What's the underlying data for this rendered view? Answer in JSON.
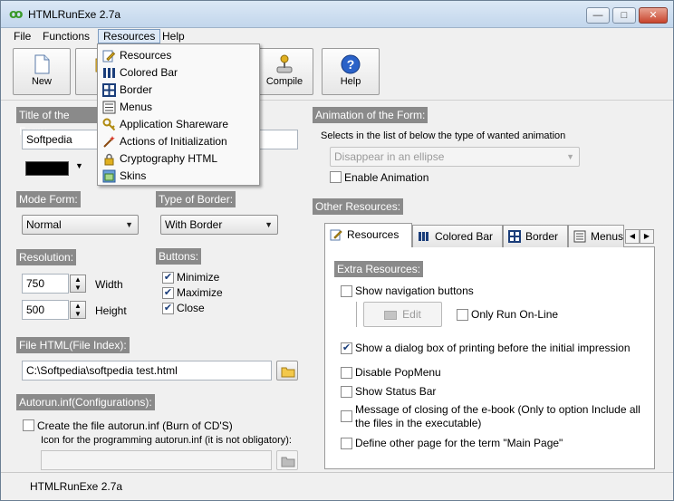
{
  "window": {
    "title": "HTMLRunExe 2.7a",
    "minimize": "—",
    "maximize": "□",
    "close": "✕"
  },
  "menubar": {
    "items": [
      "File",
      "Functions",
      "Resources",
      "Help"
    ]
  },
  "toolbar": {
    "new_label": "New",
    "open_label": "Op",
    "compile_label": "Compile",
    "help_label": "Help"
  },
  "resources_menu": {
    "items": [
      "Resources",
      "Colored Bar",
      "Border",
      "Menus",
      "Application Shareware",
      "Actions of Initialization",
      "Cryptography HTML",
      "Skins"
    ]
  },
  "form_title": {
    "label": "Title of the Form:",
    "value": "Softpedia",
    "color_value": "#000000"
  },
  "mode_form": {
    "label": "Mode Form:",
    "value": "Normal"
  },
  "border_type": {
    "label": "Type of Border:",
    "value": "With Border"
  },
  "resolution": {
    "label": "Resolution:",
    "width_value": "750",
    "width_label": "Width",
    "height_value": "500",
    "height_label": "Height"
  },
  "buttons": {
    "label": "Buttons:",
    "minimize": "Minimize",
    "maximize": "Maximize",
    "close": "Close"
  },
  "file_html": {
    "label": "File HTML(File Index):",
    "value": "C:\\Softpedia\\softpedia test.html"
  },
  "autorun": {
    "label": "Autorun.inf(Configurations):",
    "create_label": "Create the file autorun.inf (Burn of CD'S)",
    "icon_label": "Icon for the programming autorun.inf (it is not obligatory):",
    "icon_value": ""
  },
  "animation": {
    "label": "Animation of the Form:",
    "hint": "Selects in the list of below the type of wanted animation",
    "value": "Disappear in an ellipse",
    "enable_label": "Enable Animation"
  },
  "other_resources": {
    "label": "Other Resources:",
    "tabs": [
      "Resources",
      "Colored Bar",
      "Border",
      "Menus"
    ],
    "extra_label": "Extra Resources:",
    "options": {
      "show_nav": "Show navigation buttons",
      "edit": "Edit",
      "only_run_online": "Only Run On-Line",
      "show_print_dialog": "Show a dialog box of printing before the initial impression",
      "disable_popmenu": "Disable PopMenu",
      "show_status_bar": "Show Status Bar",
      "closing_message": "Message of closing of the e-book (Only to option Include all the files in the executable)",
      "define_main_page": "Define other page for the term \"Main Page\""
    }
  },
  "statusbar": {
    "text": "HTMLRunExe 2.7a"
  },
  "colors": {
    "group_header": "#8a8a8a",
    "accent": "#1a56b8"
  }
}
